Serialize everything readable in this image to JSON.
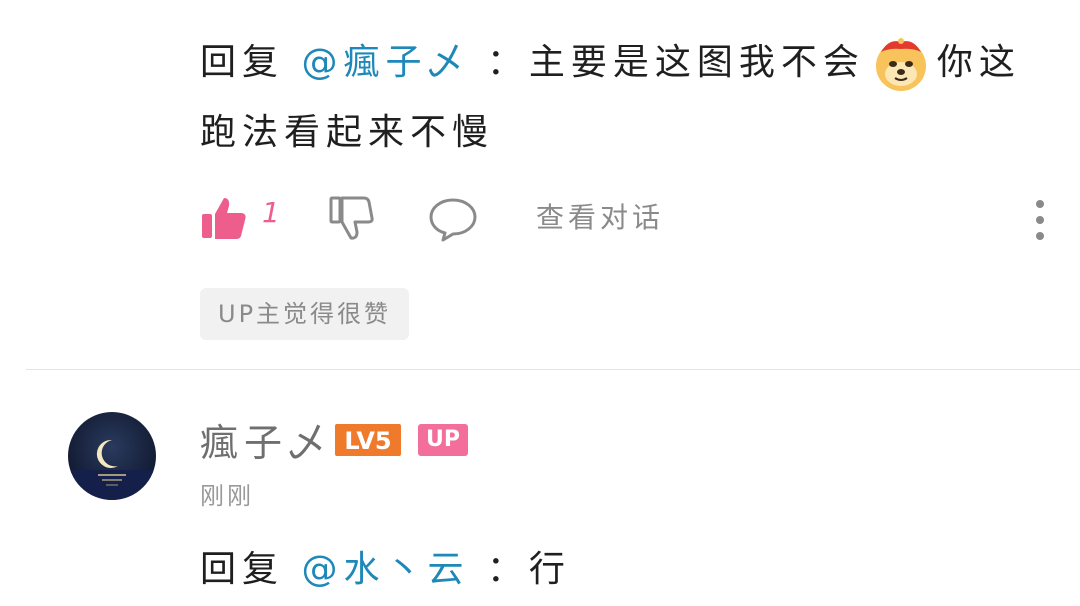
{
  "comment1": {
    "reply_prefix": "回复 ",
    "mention": "@瘋子乄",
    "text_before_emoji": " ：主要是这图我不会",
    "emoji": "doge-emoji",
    "text_after_emoji": "你这跑法看起来不慢",
    "like_count": "1",
    "view_conversation": "查看对话",
    "up_liked_badge": "UP主觉得很赞"
  },
  "comment2": {
    "username": "瘋子乄",
    "level": "LV5",
    "up_tag": "UP",
    "time": "刚刚",
    "reply_prefix": "回复 ",
    "mention": "@水丶云",
    "text": " ：行"
  },
  "colors": {
    "mention": "#1e88b8",
    "like_active": "#ee5e8c",
    "level_badge": "#ef7a2c",
    "up_tag": "#f36e9a"
  }
}
